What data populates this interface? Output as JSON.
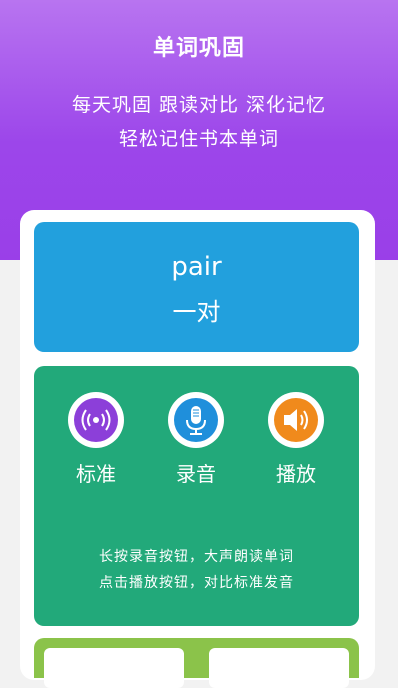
{
  "header": {
    "title": "单词巩固",
    "subtitle_line1": "每天巩固 跟读对比 深化记忆",
    "subtitle_line2": "轻松记住书本单词"
  },
  "word_card": {
    "word": "pair",
    "meaning": "一对"
  },
  "practice": {
    "buttons": [
      {
        "label": "标准",
        "icon": "speaker-wave-icon",
        "color": "#8c3fd9"
      },
      {
        "label": "录音",
        "icon": "microphone-icon",
        "color": "#1f8fdb"
      },
      {
        "label": "播放",
        "icon": "volume-icon",
        "color": "#f08a1c"
      }
    ],
    "hint_line1": "长按录音按钮，大声朗读单词",
    "hint_line2": "点击播放按钮，对比标准发音"
  },
  "colors": {
    "header_purple": "#9c46ea",
    "word_card_blue": "#22a0dd",
    "practice_green": "#22a97a",
    "bottom_green": "#8bc34a"
  }
}
